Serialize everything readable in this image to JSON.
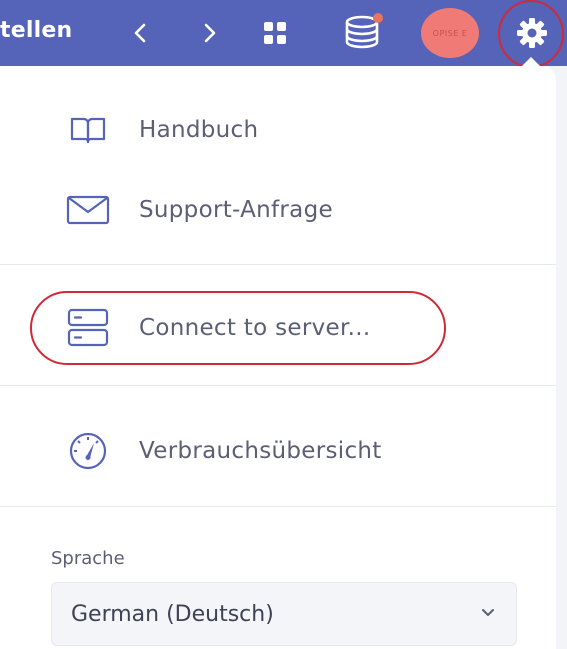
{
  "header": {
    "title_fragment": "tellen",
    "avatar_text": "OPISE E",
    "buttons": [
      {
        "name": "back",
        "icon": "chevron-left-icon"
      },
      {
        "name": "forward",
        "icon": "chevron-right-icon"
      },
      {
        "name": "apps",
        "icon": "grid-icon"
      },
      {
        "name": "database",
        "icon": "database-icon",
        "has_notification": true
      },
      {
        "name": "settings",
        "icon": "gear-icon",
        "highlighted": true
      }
    ]
  },
  "menu": {
    "items": [
      {
        "label": "Handbuch",
        "icon": "book-icon"
      },
      {
        "label": "Support-Anfrage",
        "icon": "envelope-icon"
      },
      {
        "label": "Connect to server...",
        "icon": "server-icon",
        "highlighted": true
      },
      {
        "label": "Verbrauchsübersicht",
        "icon": "gauge-icon"
      }
    ]
  },
  "language": {
    "label": "Sprache",
    "selected": "German (Deutsch)"
  },
  "colors": {
    "header_bg": "#5563b8",
    "highlight_red": "#cf2a36",
    "avatar": "#f07b76",
    "notification_dot": "#e8735f",
    "icon_color": "#5563b8"
  }
}
